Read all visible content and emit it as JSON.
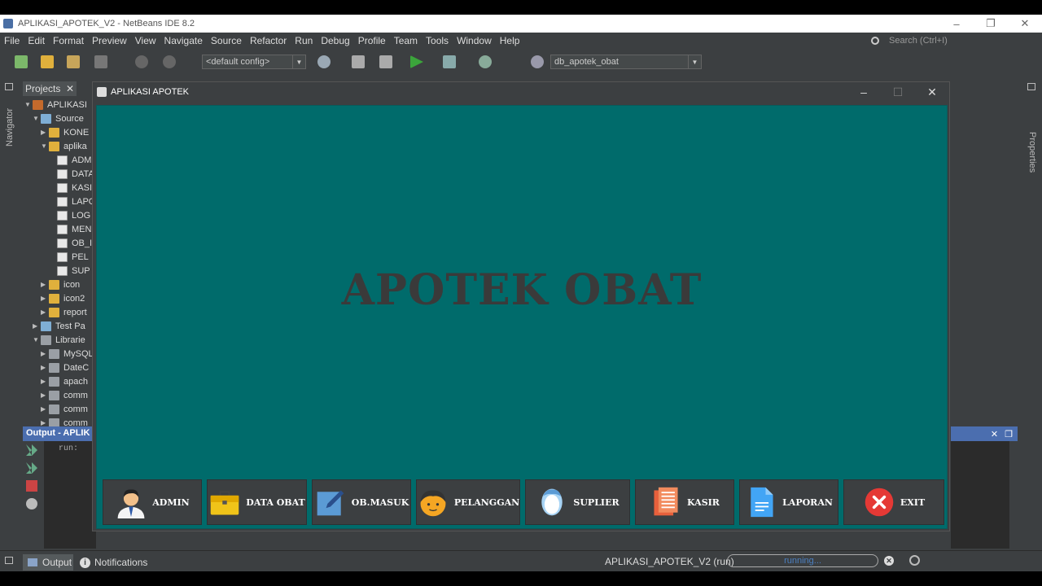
{
  "window": {
    "title": "APLIKASI_APOTEK_V2 - NetBeans IDE 8.2",
    "controls": [
      "–",
      "❐",
      "✕"
    ]
  },
  "menu": [
    "File",
    "Edit",
    "Format",
    "Preview",
    "View",
    "Navigate",
    "Source",
    "Refactor",
    "Run",
    "Debug",
    "Profile",
    "Team",
    "Tools",
    "Window",
    "Help"
  ],
  "search": {
    "placeholder": "Search (Ctrl+I)"
  },
  "toolbar": {
    "config": "<default config>",
    "database": "db_apotek_obat"
  },
  "side": {
    "navigator": "Navigator",
    "properties": "Properties"
  },
  "projects": {
    "tab": "Projects",
    "tree": [
      {
        "label": "APLIKASI",
        "kind": "proj",
        "level": 0,
        "tw": "▼"
      },
      {
        "label": "Source",
        "kind": "src",
        "level": 1,
        "tw": "▼"
      },
      {
        "label": "KONE",
        "kind": "folder",
        "level": 2,
        "tw": "▶"
      },
      {
        "label": "aplika",
        "kind": "folder",
        "level": 2,
        "tw": "▼"
      },
      {
        "label": "ADM",
        "kind": "file",
        "level": 3,
        "tw": ""
      },
      {
        "label": "DATA",
        "kind": "file",
        "level": 3,
        "tw": ""
      },
      {
        "label": "KASI",
        "kind": "file",
        "level": 3,
        "tw": ""
      },
      {
        "label": "LAPO",
        "kind": "file",
        "level": 3,
        "tw": ""
      },
      {
        "label": "LOG",
        "kind": "file",
        "level": 3,
        "tw": ""
      },
      {
        "label": "MEN",
        "kind": "file",
        "level": 3,
        "tw": ""
      },
      {
        "label": "OB_I",
        "kind": "file",
        "level": 3,
        "tw": ""
      },
      {
        "label": "PEL",
        "kind": "file",
        "level": 3,
        "tw": ""
      },
      {
        "label": "SUP",
        "kind": "file",
        "level": 3,
        "tw": ""
      },
      {
        "label": "icon",
        "kind": "folder",
        "level": 2,
        "tw": "▶"
      },
      {
        "label": "icon2",
        "kind": "folder",
        "level": 2,
        "tw": "▶"
      },
      {
        "label": "report",
        "kind": "folder",
        "level": 2,
        "tw": "▶"
      },
      {
        "label": "Test Pa",
        "kind": "src",
        "level": 1,
        "tw": "▶"
      },
      {
        "label": "Librarie",
        "kind": "lib",
        "level": 1,
        "tw": "▼"
      },
      {
        "label": "MySQL",
        "kind": "lib",
        "level": 2,
        "tw": "▶"
      },
      {
        "label": "DateC",
        "kind": "lib",
        "level": 2,
        "tw": "▶"
      },
      {
        "label": "apach",
        "kind": "lib",
        "level": 2,
        "tw": "▶"
      },
      {
        "label": "comm",
        "kind": "lib",
        "level": 2,
        "tw": "▶"
      },
      {
        "label": "comm",
        "kind": "lib",
        "level": 2,
        "tw": "▶"
      },
      {
        "label": "comm",
        "kind": "lib",
        "level": 2,
        "tw": "▶"
      }
    ]
  },
  "output": {
    "header": "Output - APLIK",
    "console": "run:"
  },
  "status": {
    "output_tab": "Output",
    "notifications": "Notifications",
    "run_label": "APLIKASI_APOTEK_V2 (run)",
    "progress": "running..."
  },
  "app": {
    "title": "APLIKASI APOTEK",
    "heading": "APOTEK OBAT",
    "background": "#006b6b",
    "buttons": [
      {
        "label": "ADMIN",
        "icon": "admin-icon"
      },
      {
        "label": "DATA OBAT",
        "icon": "briefcase-icon"
      },
      {
        "label": "OB.MASUK",
        "icon": "edit-icon"
      },
      {
        "label": "PELANGGAN",
        "icon": "customer-icon"
      },
      {
        "label": "SUPLIER",
        "icon": "supplier-icon"
      },
      {
        "label": "KASIR",
        "icon": "receipt-icon"
      },
      {
        "label": "LAPORAN",
        "icon": "document-icon"
      },
      {
        "label": "EXIT",
        "icon": "exit-icon"
      }
    ]
  }
}
